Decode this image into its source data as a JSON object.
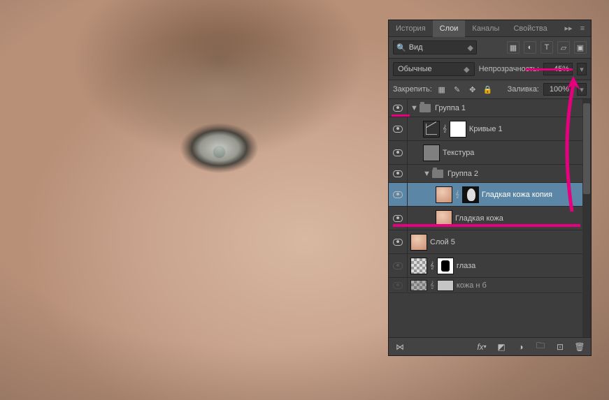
{
  "tabs": {
    "history": "История",
    "layers": "Слои",
    "channels": "Каналы",
    "properties": "Свойства"
  },
  "filter": {
    "label": "Вид"
  },
  "blend": {
    "mode": "Обычные",
    "opacity_label": "Непрозрачность:",
    "opacity": "45%"
  },
  "lock": {
    "label": "Закрепить:",
    "fill_label": "Заливка:",
    "fill": "100%"
  },
  "layers": [
    {
      "name": "Группа 1"
    },
    {
      "name": "Кривые 1"
    },
    {
      "name": "Текстура"
    },
    {
      "name": "Группа 2"
    },
    {
      "name": "Гладкая кожа копия"
    },
    {
      "name": "Гладкая кожа"
    },
    {
      "name": "Слой 5"
    },
    {
      "name": "глаза"
    },
    {
      "name": "кожа н б"
    }
  ]
}
